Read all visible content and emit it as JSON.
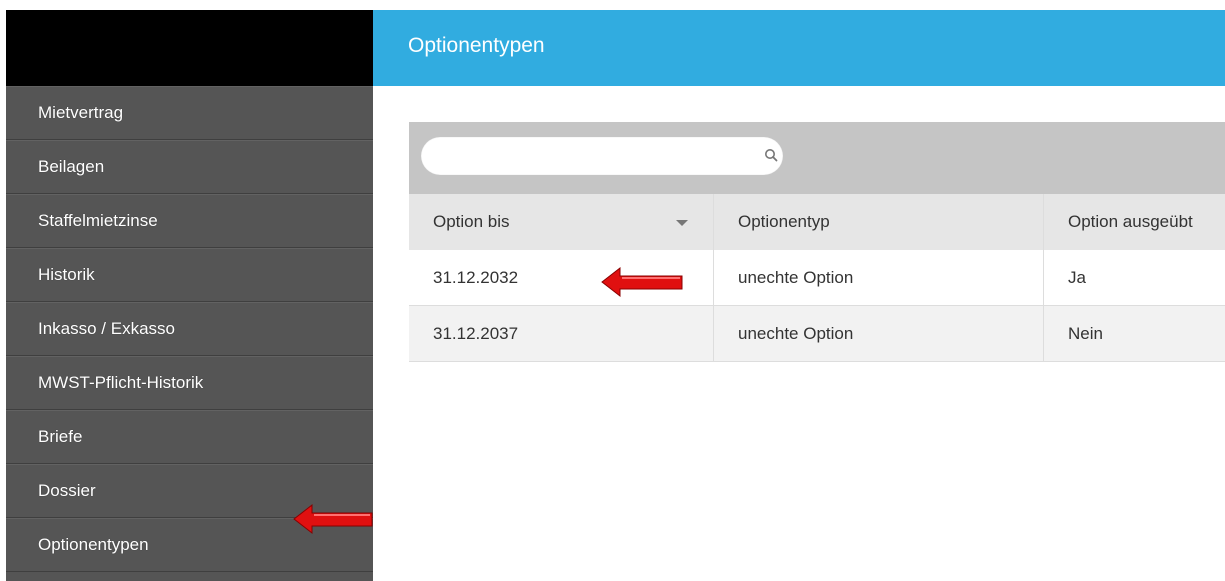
{
  "sidebar": {
    "items": [
      {
        "label": "Mietvertrag"
      },
      {
        "label": "Beilagen"
      },
      {
        "label": "Staffelmietzinse"
      },
      {
        "label": "Historik"
      },
      {
        "label": "Inkasso / Exkasso"
      },
      {
        "label": "MWST-Pflicht-Historik"
      },
      {
        "label": "Briefe"
      },
      {
        "label": "Dossier"
      },
      {
        "label": "Optionentypen"
      }
    ]
  },
  "header": {
    "title": "Optionentypen"
  },
  "search": {
    "placeholder": "",
    "value": "",
    "icon": "search-icon"
  },
  "table": {
    "columns": [
      "Option bis",
      "Optionentyp",
      "Option ausgeübt"
    ],
    "sort_icon": "caret-down-icon",
    "rows": [
      [
        "31.12.2032",
        "unechte Option",
        "Ja"
      ],
      [
        "31.12.2037",
        "unechte Option",
        "Nein"
      ]
    ]
  },
  "colors": {
    "header_bg": "#31ace0",
    "sidebar_bg": "#555555",
    "annotation_arrow": "#e01010"
  }
}
